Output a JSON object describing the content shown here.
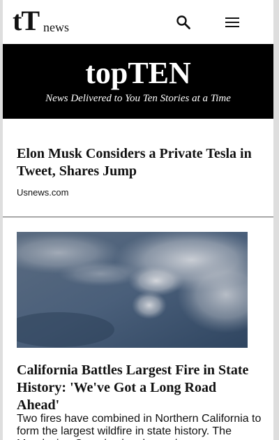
{
  "header": {
    "logo_tt": "tT",
    "logo_news": "news",
    "search_icon": "search-icon",
    "menu_icon": "hamburger-menu-icon"
  },
  "banner": {
    "title": "topTEN",
    "subtitle": "News Delivered to You Ten Stories at a Time",
    "background": "#000000"
  },
  "articles": [
    {
      "headline": "Elon Musk Considers a Private Tesla in Tweet, Shares Jump",
      "source": "Usnews.com"
    },
    {
      "image": "aerial-wildfire-smoke-photo",
      "headline": "California Battles Largest Fire in State History: 'We've Got a Long Road Ahead'",
      "summary": "Two fires have combined in Northern California to form the largest wildfire in state history. The Mendocino Complex has burned ..."
    }
  ]
}
